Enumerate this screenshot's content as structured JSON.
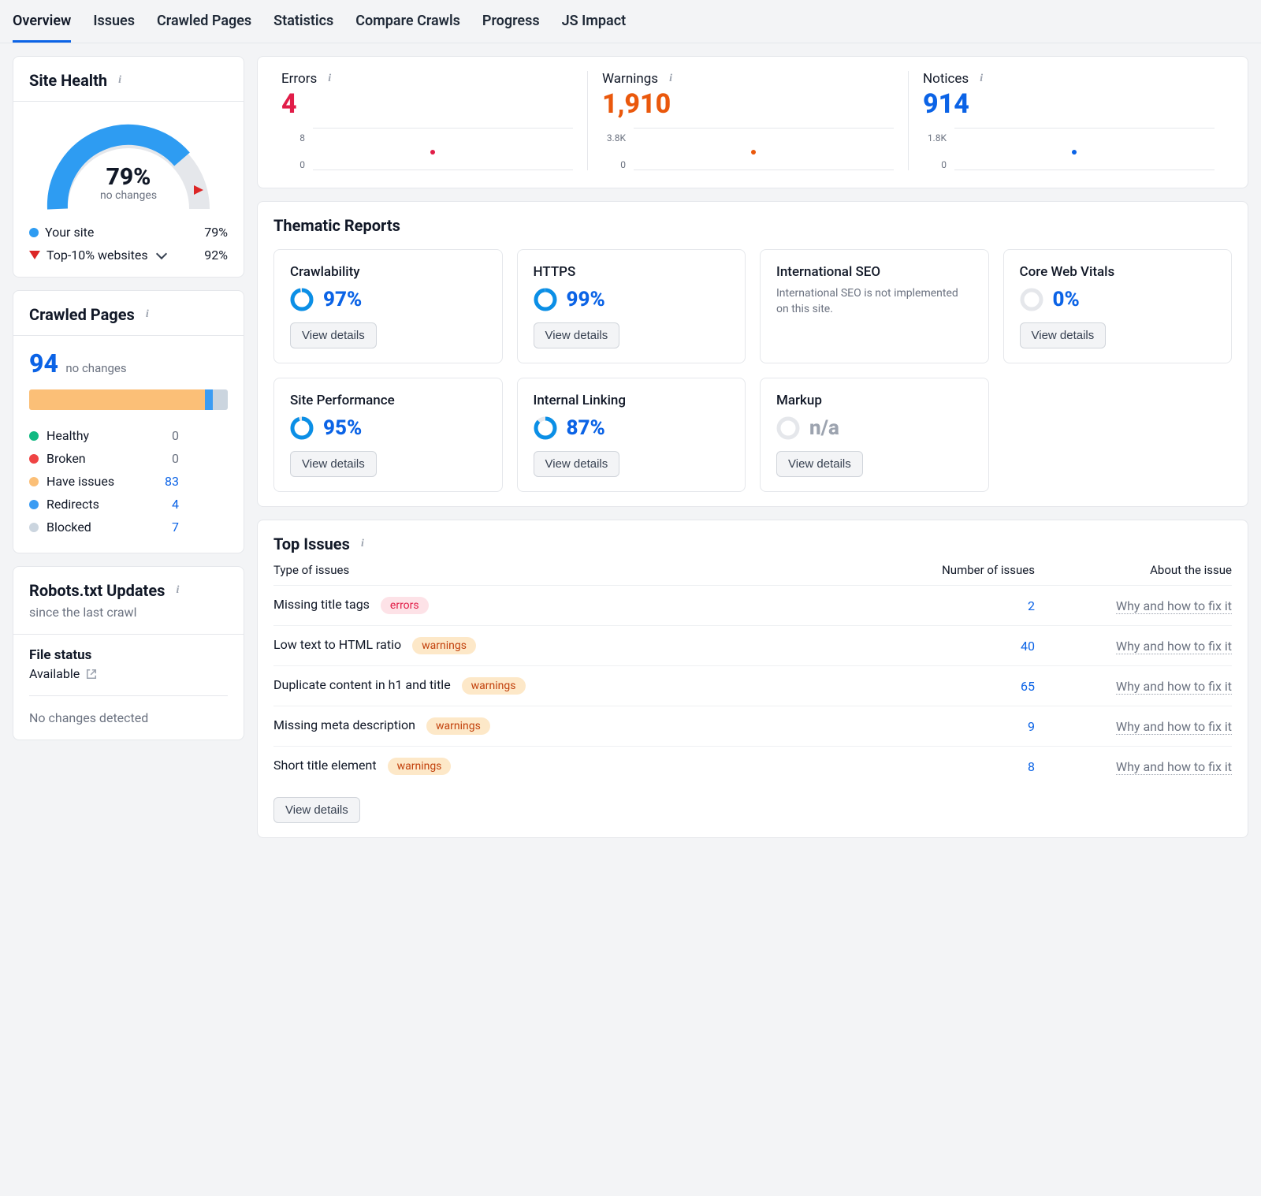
{
  "tabs": [
    "Overview",
    "Issues",
    "Crawled Pages",
    "Statistics",
    "Compare Crawls",
    "Progress",
    "JS Impact"
  ],
  "active_tab": "Overview",
  "site_health": {
    "title": "Site Health",
    "percent": "79%",
    "subtitle": "no changes",
    "legend": {
      "your_site_label": "Your site",
      "your_site_value": "79%",
      "top10_label": "Top-10% websites",
      "top10_value": "92%"
    }
  },
  "crawled_pages": {
    "title": "Crawled Pages",
    "count": "94",
    "subtitle": "no changes",
    "rows": [
      {
        "color": "#10b981",
        "label": "Healthy",
        "value": "0",
        "cls": "gray"
      },
      {
        "color": "#ef4444",
        "label": "Broken",
        "value": "0",
        "cls": "gray"
      },
      {
        "color": "#fbbf77",
        "label": "Have issues",
        "value": "83",
        "cls": "blue"
      },
      {
        "color": "#3b9cf3",
        "label": "Redirects",
        "value": "4",
        "cls": "blue"
      },
      {
        "color": "#cbd5df",
        "label": "Blocked",
        "value": "7",
        "cls": "blue"
      }
    ]
  },
  "robots": {
    "title": "Robots.txt Updates",
    "since": "since the last crawl",
    "file_status_title": "File status",
    "file_status_value": "Available",
    "no_changes": "No changes detected"
  },
  "stats": {
    "errors": {
      "label": "Errors",
      "value": "4",
      "top": "8",
      "bottom": "0",
      "dot_color": "#e11d48"
    },
    "warnings": {
      "label": "Warnings",
      "value": "1,910",
      "top": "3.8K",
      "bottom": "0",
      "dot_color": "#ea580c"
    },
    "notices": {
      "label": "Notices",
      "value": "914",
      "top": "1.8K",
      "bottom": "0",
      "dot_color": "#0b63e6"
    }
  },
  "thematic": {
    "title": "Thematic Reports",
    "view_details_label": "View details",
    "cards": [
      {
        "title": "Crawlability",
        "pct": "97%",
        "donut": 97,
        "btn": true
      },
      {
        "title": "HTTPS",
        "pct": "99%",
        "donut": 99,
        "btn": true
      },
      {
        "title": "International SEO",
        "note": "International SEO is not implemented on this site.",
        "btn": false
      },
      {
        "title": "Core Web Vitals",
        "pct": "0%",
        "donut": 0,
        "btn": true
      },
      {
        "title": "Site Performance",
        "pct": "95%",
        "donut": 95,
        "btn": true
      },
      {
        "title": "Internal Linking",
        "pct": "87%",
        "donut": 87,
        "btn": true
      },
      {
        "title": "Markup",
        "pct": "n/a",
        "donut": null,
        "btn": true,
        "gray": true
      }
    ]
  },
  "top_issues": {
    "title": "Top Issues",
    "headers": {
      "type": "Type of issues",
      "num": "Number of issues",
      "about": "About the issue"
    },
    "about_label": "Why and how to fix it",
    "view_details_label": "View details",
    "rows": [
      {
        "name": "Missing title tags",
        "pill": "errors",
        "count": "2"
      },
      {
        "name": "Low text to HTML ratio",
        "pill": "warnings",
        "count": "40"
      },
      {
        "name": "Duplicate content in h1 and title",
        "pill": "warnings",
        "count": "65"
      },
      {
        "name": "Missing meta description",
        "pill": "warnings",
        "count": "9"
      },
      {
        "name": "Short title element",
        "pill": "warnings",
        "count": "8"
      }
    ]
  }
}
